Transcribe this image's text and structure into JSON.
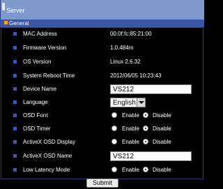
{
  "header": {
    "title": "Server",
    "section": "General"
  },
  "settings": [
    {
      "label": "MAC Address",
      "value": "00:0f:fc:85:21:00"
    },
    {
      "label": "Firmware Version",
      "value": "1.0.484m"
    },
    {
      "label": "OS Version",
      "value": "Linux 2.6.32"
    },
    {
      "label": "System Reboot Time",
      "value": "2012/06/05 10:23:43"
    },
    {
      "label": "Device Name",
      "value": "VS212"
    },
    {
      "label": "Language",
      "value": "English"
    },
    {
      "label": "OSD Font",
      "enable": "Enable",
      "disable": "Disable",
      "selected": "disable"
    },
    {
      "label": "OSD Timer",
      "enable": "Enable",
      "disable": "Disable",
      "selected": "disable"
    },
    {
      "label": "ActiveX OSD Display",
      "enable": "Enable",
      "disable": "Disable",
      "selected": "disable"
    },
    {
      "label": "ActiveX OSD Name",
      "value": "VS212"
    },
    {
      "label": "Low Latency Mode",
      "enable": "Enable",
      "disable": "Disable",
      "selected": "disable"
    }
  ],
  "actions": {
    "submit_label": "Submit"
  },
  "colors": {
    "title_bar": "#7f99cc",
    "section_bar": "#3a57a5",
    "section_marker": "#f2a623",
    "bullet": "#2f59cf",
    "background": "#000000"
  }
}
